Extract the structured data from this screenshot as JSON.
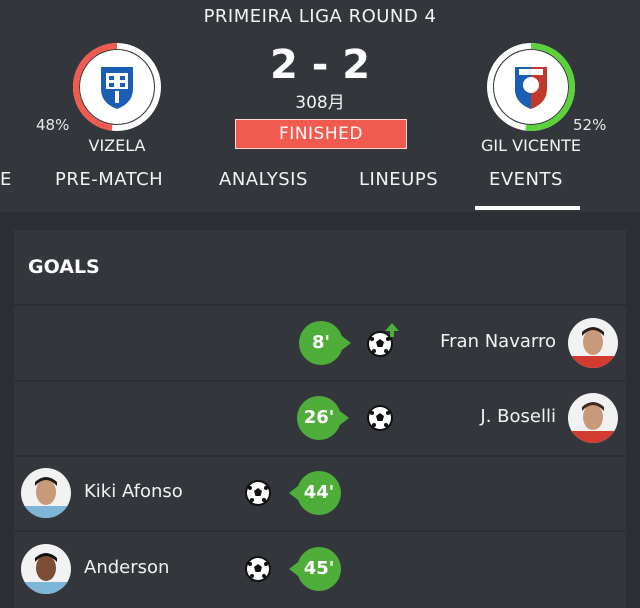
{
  "match": {
    "round_title": "PRIMEIRA LIGA ROUND 4",
    "score": "2 - 2",
    "score_sub": "308月",
    "status": "FINISHED",
    "home": {
      "name": "VIZELA",
      "possession": "48%",
      "possession_value": 0.48,
      "ring_color": "#f05a4f"
    },
    "away": {
      "name": "GIL VICENTE",
      "possession": "52%",
      "possession_value": 0.52,
      "ring_color": "#5bd13a"
    }
  },
  "tabs": [
    {
      "label": "E"
    },
    {
      "label": "PRE-MATCH"
    },
    {
      "label": "ANALYSIS"
    },
    {
      "label": "LINEUPS"
    },
    {
      "label": "EVENTS",
      "active": true
    }
  ],
  "goals": {
    "title": "GOALS",
    "events": [
      {
        "minute": "8'",
        "player": "Fran Navarro",
        "side": "away",
        "icon": "soccer-ball-icon",
        "extra_icon": "arrow-up-icon"
      },
      {
        "minute": "26'",
        "player": "J. Boselli",
        "side": "away",
        "icon": "soccer-ball-icon"
      },
      {
        "minute": "44'",
        "player": "Kiki Afonso",
        "side": "home",
        "icon": "soccer-ball-icon"
      },
      {
        "minute": "45'",
        "player": "Anderson",
        "side": "home",
        "icon": "soccer-ball-icon"
      }
    ]
  },
  "colors": {
    "background": "#2b2e33",
    "panel": "#33363b",
    "goal_green": "#4fae3a",
    "status_red": "#f05a4f"
  }
}
